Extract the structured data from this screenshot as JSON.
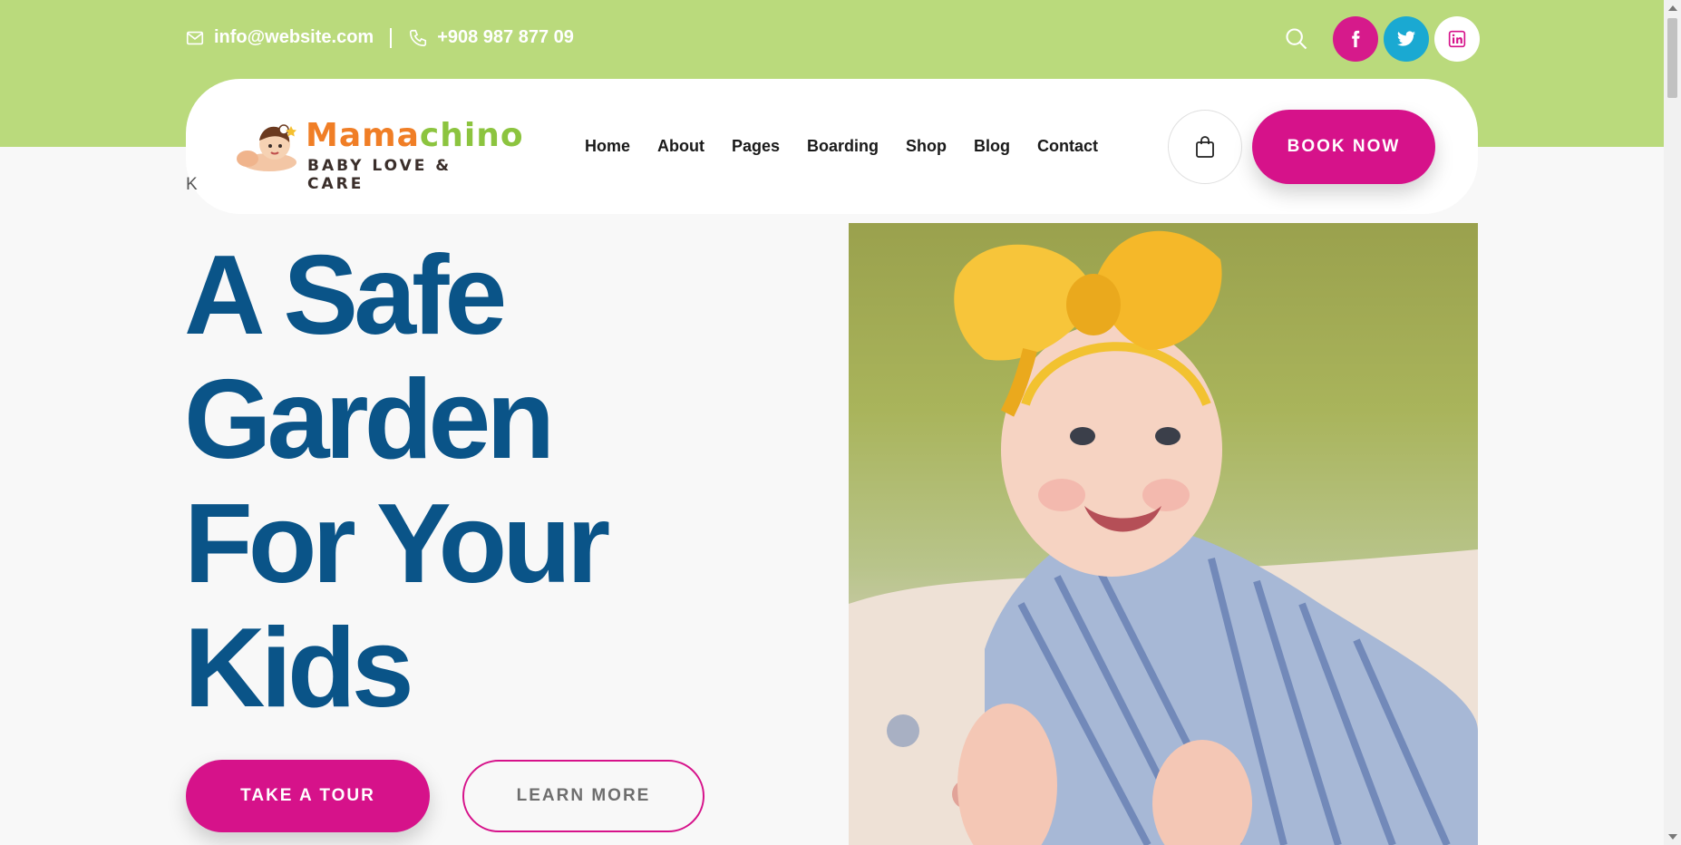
{
  "topbar": {
    "email": "info@website.com",
    "phone": "+908 987 877 09",
    "icons": {
      "email": "mail-icon",
      "phone": "phone-icon",
      "search": "search-icon"
    },
    "social": [
      {
        "name": "facebook",
        "glyph": "f",
        "color": "#d61a8b"
      },
      {
        "name": "twitter",
        "glyph": "twitter-bird",
        "color": "#1aa9d2"
      },
      {
        "name": "linkedin",
        "glyph": "in",
        "color": "#ffffff"
      }
    ],
    "background": "#bada7c"
  },
  "logo": {
    "title_part1": "Mama",
    "title_part2": "chino",
    "subtitle": "BABY LOVE & CARE"
  },
  "nav": {
    "items": [
      {
        "label": "Home"
      },
      {
        "label": "About"
      },
      {
        "label": "Pages"
      },
      {
        "label": "Boarding"
      },
      {
        "label": "Shop"
      },
      {
        "label": "Blog"
      },
      {
        "label": "Contact"
      }
    ],
    "cart_icon": "shopping-bag-icon",
    "book_label": "BOOK NOW"
  },
  "breadcrumb": "K",
  "hero": {
    "headline": [
      "A Safe",
      "Garden",
      "For Your",
      "Kids"
    ],
    "tour_label": "TAKE A TOUR",
    "learn_label": "LEARN MORE",
    "photo": "smiling-baby-with-yellow-bow-photo"
  },
  "colors": {
    "accent_pink": "#d6128a",
    "headline_blue": "#0a5488",
    "green": "#bada7c"
  }
}
